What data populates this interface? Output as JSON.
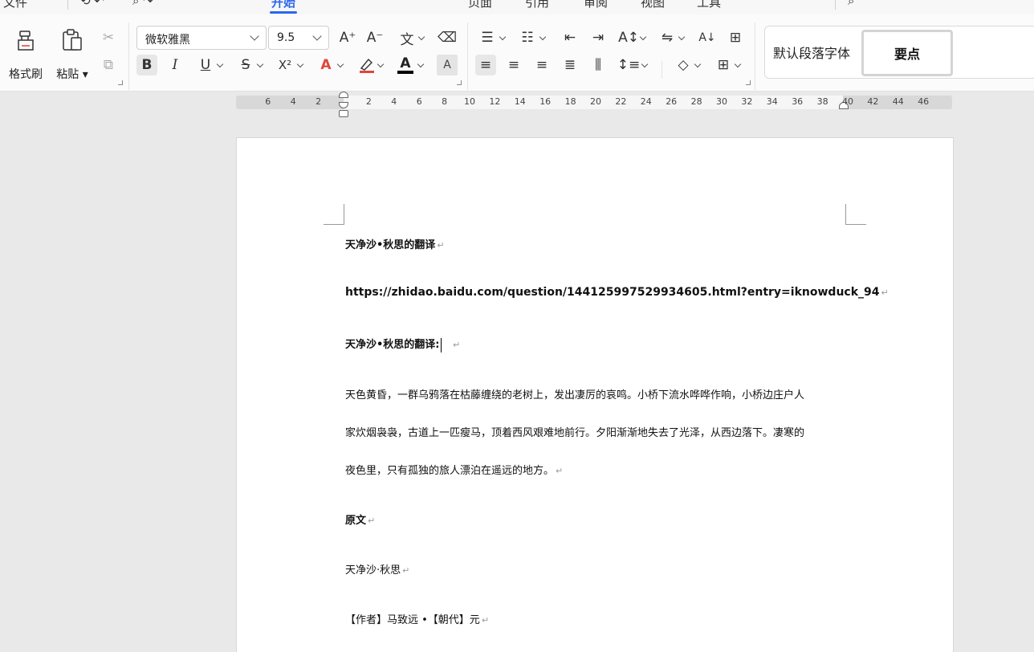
{
  "tabs": [
    {
      "label": "文件"
    },
    {
      "label": "开始",
      "active": true
    },
    {
      "label": "页面"
    },
    {
      "label": "引用"
    },
    {
      "label": "审阅"
    },
    {
      "label": "视图"
    },
    {
      "label": "工具"
    }
  ],
  "ribbon": {
    "format_painter": "格式刷",
    "paste": "粘贴",
    "font_name": "微软雅黑",
    "font_size": "9.5",
    "style_default": "默认段落字体",
    "style_highlight": "要点"
  },
  "icons": {
    "bold": "B",
    "italic": "I",
    "underline": "U",
    "strikethrough": "S",
    "superscript": "X²",
    "text_effect": "A",
    "font_color": "A",
    "char_shading": "A",
    "grow_font": "A⁺",
    "shrink_font": "A⁻",
    "sort": "A↓"
  },
  "ruler": {
    "labels": [
      "6",
      "4",
      "2",
      "2",
      "4",
      "6",
      "8",
      "10",
      "12",
      "14",
      "16",
      "18",
      "20",
      "22",
      "24",
      "26",
      "28",
      "30",
      "32",
      "34",
      "36",
      "38",
      "40",
      "42",
      "44",
      "46"
    ]
  },
  "document": {
    "paragraphs": [
      {
        "text": "天净沙•秋思的翻译",
        "bold": true
      },
      {
        "text": "https://zhidao.baidu.com/question/144125997529934605.html?entry=iknowduck_94",
        "bold": true
      },
      {
        "text": "天净沙•秋思的翻译:",
        "bold": true
      },
      {
        "text": "天色黄昏，一群乌鸦落在枯藤缠绕的老树上，发出凄厉的哀鸣。小桥下流水哗哗作响，小桥边庄户人"
      },
      {
        "text": "家炊烟袅袅，古道上一匹瘦马，顶着西风艰难地前行。夕阳渐渐地失去了光泽，从西边落下。凄寒的"
      },
      {
        "text": "夜色里，只有孤独的旅人漂泊在遥远的地方。"
      },
      {
        "text": "原文",
        "bold": true
      },
      {
        "text": "天净沙·秋思"
      },
      {
        "text": "【作者】马致远 •【朝代】元"
      }
    ],
    "paragraph_mark": "↵"
  },
  "colors": {
    "accent": "#2b66f0",
    "font_color_bar": "#000000",
    "highlight_bar": "#e0463a"
  }
}
